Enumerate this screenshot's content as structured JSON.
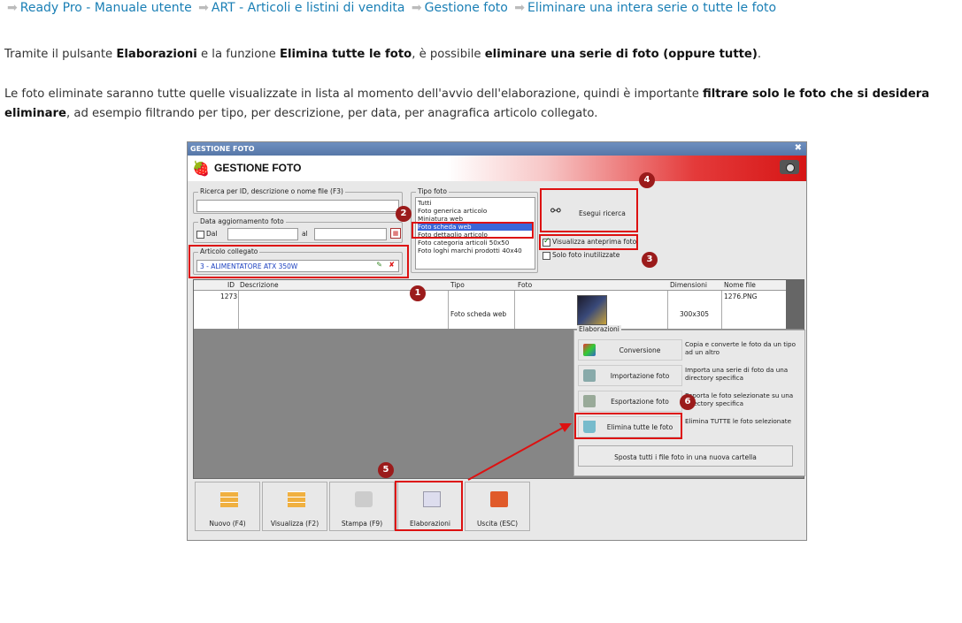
{
  "breadcrumb": [
    "Ready Pro - Manuale utente",
    "ART - Articoli e listini di vendita",
    "Gestione foto",
    "Eliminare una intera serie o tutte le foto"
  ],
  "para1": {
    "t1": "Tramite il pulsante ",
    "b1": "Elaborazioni",
    "t2": " e la funzione ",
    "b2": "Elimina tutte le foto",
    "t3": ", è possibile ",
    "b3": "eliminare una serie di foto (oppure tutte)",
    "t4": "."
  },
  "para2": {
    "t1": "Le foto eliminate saranno tutte quelle visualizzate in lista al momento dell'avvio dell'elaborazione, quindi è importante ",
    "b1": "filtrare solo le foto che si desidera eliminare",
    "t2": ", ad esempio filtrando per tipo, per descrizione, per data, per anagrafica articolo collegato."
  },
  "window": {
    "title": "GESTIONE FOTO",
    "header": "GESTIONE FOTO",
    "search_legend": "Ricerca per ID, descrizione o nome file (F3)",
    "date_legend": "Data aggiornamento foto",
    "date_from": "Dal",
    "date_to": "al",
    "article_legend": "Articolo collegato",
    "article_value": "3 - ALIMENTATORE ATX 350W",
    "tipo_legend": "Tipo foto",
    "tipo_options": [
      "Tutti",
      "Foto generica articolo",
      "Miniatura web",
      "Foto scheda web",
      "Foto dettaglio articolo",
      "Foto categoria articoli 50x50",
      "Foto loghi marchi prodotti 40x40"
    ],
    "tipo_selected": "Foto scheda web",
    "search_button": "Esegui ricerca",
    "preview_check": "Visualizza anteprima foto",
    "unused_check": "Solo foto inutilizzate",
    "columns": [
      "ID",
      "Descrizione",
      "Tipo",
      "Foto",
      "Dimensioni",
      "Nome file"
    ],
    "row": {
      "id": "1273",
      "descrizione": "",
      "tipo": "Foto scheda web",
      "dimensioni": "300x305",
      "nome_file": "1276.PNG"
    },
    "elab_legend": "Elaborazioni",
    "elab_buttons": [
      {
        "label": "Conversione",
        "desc": "Copia e converte le foto da un tipo ad un altro"
      },
      {
        "label": "Importazione foto",
        "desc": "Importa una serie di foto da una directory specifica"
      },
      {
        "label": "Esportazione foto",
        "desc": "Esporta le foto selezionate su una directory specifica"
      },
      {
        "label": "Elimina tutte le foto",
        "desc": "Elimina TUTTE le foto selezionate"
      }
    ],
    "move_button": "Sposta tutti i file foto in una nuova cartella",
    "toolbar": [
      "Nuovo (F4)",
      "Visualizza (F2)",
      "Stampa (F9)",
      "Elaborazioni",
      "Uscita (ESC)"
    ]
  },
  "badges": [
    "1",
    "2",
    "3",
    "4",
    "5",
    "6"
  ],
  "colors": {
    "link": "#1a7fb5",
    "highlight": "#dd1111",
    "badge": "#9b1b1b"
  }
}
